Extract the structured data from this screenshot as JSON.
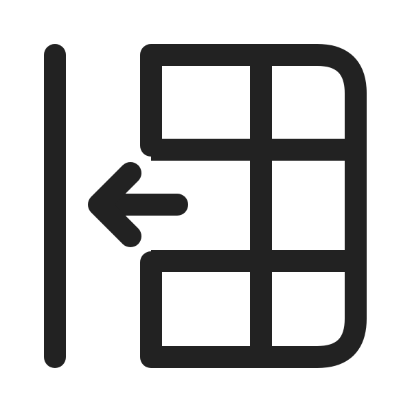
{
  "icon": {
    "name": "table-collapse-left-icon",
    "stroke_color": "#222222",
    "background_color": "#ffffff"
  }
}
